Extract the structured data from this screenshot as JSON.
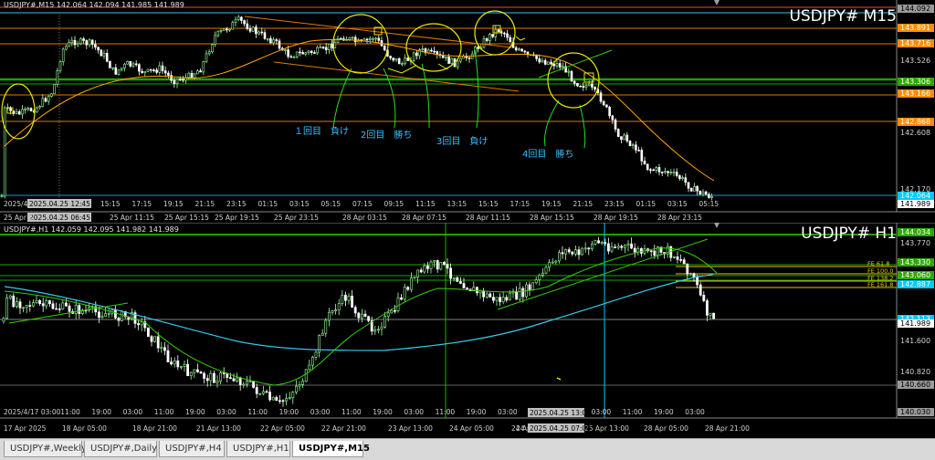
{
  "colors": {
    "bg": "#000000",
    "bull": "#9cff9c",
    "bear": "#ffffff",
    "ma_orange": "#ffa500",
    "ma_cyan": "#35c8e8",
    "ma_green": "#34d000",
    "grid": "#2a2a2a",
    "annot": "#38c0ff",
    "yellow": "#e8e800"
  },
  "top": {
    "info": "USDJPY#,M15  142.064 142.094 141.985 141.989",
    "symbol": "USDJPY# M15",
    "price_labels": [
      {
        "text": "144.092",
        "kind": "gray"
      },
      {
        "text": "143.891",
        "kind": "orange"
      },
      {
        "text": "143.716",
        "kind": "orange"
      },
      {
        "text": "143.526",
        "kind": "plain"
      },
      {
        "text": "143.306",
        "kind": "green"
      },
      {
        "text": "143.166",
        "kind": "orange"
      },
      {
        "text": "142.868",
        "kind": "orange"
      },
      {
        "text": "142.608",
        "kind": "plain"
      },
      {
        "text": "142.170",
        "kind": "plain"
      },
      {
        "text": "142.064",
        "kind": "cyan"
      },
      {
        "text": "141.989",
        "kind": "white"
      }
    ],
    "time_labels": [
      "25 Apr 2",
      "25 Apr 11:15",
      "25 Apr 15:15",
      "25 Apr 19:15",
      "25 Apr 23:15",
      "28 Apr 03:15",
      "28 Apr 07:15",
      "28 Apr 11:15",
      "28 Apr 15:15",
      "28 Apr 19:15",
      "28 Apr 23:15"
    ],
    "intraday_labels": [
      "15:15",
      "17:15",
      "19:15",
      "21:15",
      "23:15",
      "01:15",
      "03:15",
      "05:15",
      "07:15",
      "09:15",
      "11:15",
      "13:15",
      "15:15",
      "17:15",
      "19:15",
      "21:15",
      "23:15",
      "01:15",
      "03:15",
      "05:15"
    ],
    "cursor_date": "2025.04.25 12:45",
    "cursor_date2": "2025.04.25 06:45",
    "cursor_date_left": "2025/4/",
    "annotations": [
      "１回目　負け",
      "2回目　勝ち",
      "3回目　負け",
      "4回目　勝ち"
    ]
  },
  "bottom": {
    "info": "USDJPY#,H1  142.059 142.095 141.982 141.989",
    "symbol": "USDJPY# H1",
    "price_labels": [
      {
        "text": "144.034",
        "kind": "green"
      },
      {
        "text": "143.770",
        "kind": "plain"
      },
      {
        "text": "143.330",
        "kind": "green"
      },
      {
        "text": "143.060",
        "kind": "green"
      },
      {
        "text": "142.887",
        "kind": "cyan"
      },
      {
        "text": "142.113",
        "kind": "cyan"
      },
      {
        "text": "141.989",
        "kind": "white"
      },
      {
        "text": "141.600",
        "kind": "plain"
      },
      {
        "text": "140.820",
        "kind": "plain"
      },
      {
        "text": "140.660",
        "kind": "gray"
      },
      {
        "text": "140.030",
        "kind": "gray"
      }
    ],
    "fe_labels": [
      "FE 61.8",
      "FE 100.0",
      "FE 138.2",
      "FE 161.8"
    ],
    "time_labels": [
      "17 Apr 2025",
      "18 Apr 05:00",
      "18 Apr 21:00",
      "21 Apr 13:00",
      "22 Apr 05:00",
      "22 Apr 21:00",
      "23 Apr 13:00",
      "24 Apr 05:00",
      "24 Apr 21:00",
      "25 Apr 13:00",
      "28 Apr 05:00",
      "28 Apr 21:00"
    ],
    "hour_labels": [
      "03:00",
      "11:00",
      "19:00",
      "03:00",
      "11:00",
      "19:00",
      "03:00",
      "11:00",
      "19:00",
      "03:00",
      "11:00",
      "19:00",
      "03:00",
      "11:00",
      "19:00",
      "03:00",
      "11:00",
      "19:00",
      "03:00",
      "11:00",
      "19:00",
      "03:00"
    ],
    "cursor_date": "2025/4/17 03:00",
    "cursor_date2": "2025.04.25 13:00",
    "cursor_date3": "2025.04.25 07:00",
    "cursor_date_left": "24"
  },
  "tabs": [
    {
      "label": "USDJPY#,Weekly",
      "active": false
    },
    {
      "label": "USDJPY#,Daily",
      "active": false
    },
    {
      "label": "USDJPY#,H4",
      "active": false
    },
    {
      "label": "USDJPY#,H1",
      "active": false
    },
    {
      "label": "USDJPY#,M15",
      "active": true
    }
  ]
}
